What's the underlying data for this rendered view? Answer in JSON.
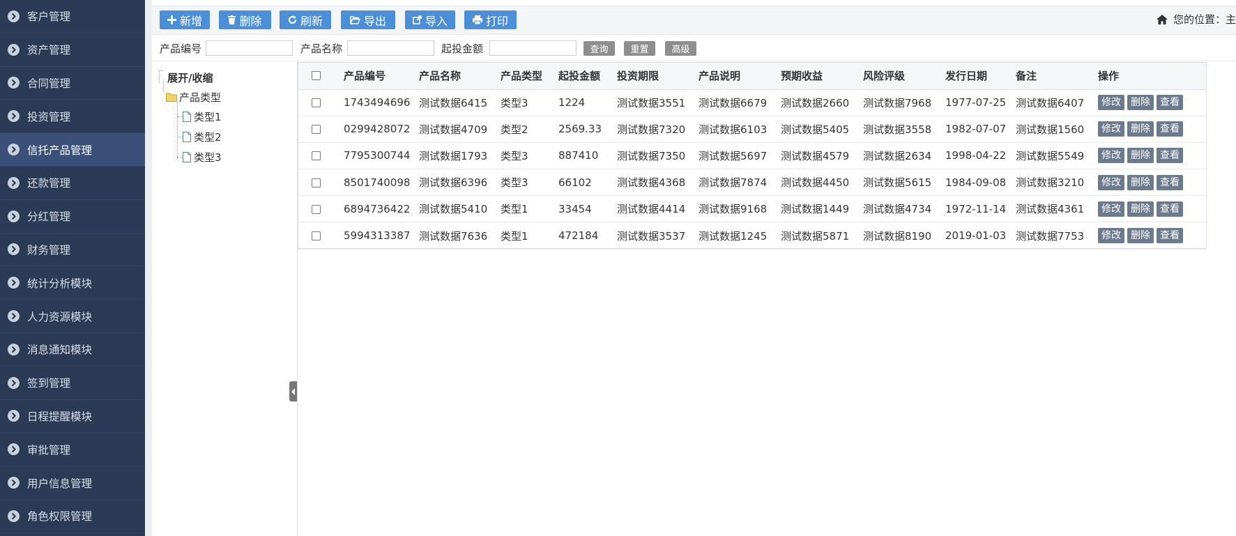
{
  "sidebar": {
    "items": [
      {
        "label": "客户管理",
        "active": false
      },
      {
        "label": "资产管理",
        "active": false
      },
      {
        "label": "合同管理",
        "active": false
      },
      {
        "label": "投资管理",
        "active": false
      },
      {
        "label": "信托产品管理",
        "active": true
      },
      {
        "label": "还款管理",
        "active": false
      },
      {
        "label": "分红管理",
        "active": false
      },
      {
        "label": "财务管理",
        "active": false
      },
      {
        "label": "统计分析模块",
        "active": false
      },
      {
        "label": "人力资源模块",
        "active": false
      },
      {
        "label": "消息通知模块",
        "active": false
      },
      {
        "label": "签到管理",
        "active": false
      },
      {
        "label": "日程提醒模块",
        "active": false
      },
      {
        "label": "审批管理",
        "active": false
      },
      {
        "label": "用户信息管理",
        "active": false
      },
      {
        "label": "角色权限管理",
        "active": false
      }
    ]
  },
  "toolbar": {
    "add": "新增",
    "delete": "删除",
    "refresh": "刷新",
    "export": "导出",
    "import": "导入",
    "print": "打印",
    "location_label": "您的位置：主"
  },
  "search": {
    "code_label": "产品编号",
    "name_label": "产品名称",
    "amount_label": "起投金额",
    "query": "查询",
    "reset": "重置",
    "advanced": "高级"
  },
  "tree": {
    "toggle": "展开/收缩",
    "root": "产品类型",
    "children": [
      "类型1",
      "类型2",
      "类型3"
    ]
  },
  "table": {
    "columns": [
      "产品编号",
      "产品名称",
      "产品类型",
      "起投金额",
      "投资期限",
      "产品说明",
      "预期收益",
      "风险评级",
      "发行日期",
      "备注",
      "操作"
    ],
    "rows": [
      [
        "1743494696",
        "测试数据6415",
        "类型3",
        "1224",
        "测试数据3551",
        "测试数据6679",
        "测试数据2660",
        "测试数据7968",
        "1977-07-25",
        "测试数据6407"
      ],
      [
        "0299428072",
        "测试数据4709",
        "类型2",
        "2569.33",
        "测试数据7320",
        "测试数据6103",
        "测试数据5405",
        "测试数据3558",
        "1982-07-07",
        "测试数据1560"
      ],
      [
        "7795300744",
        "测试数据1793",
        "类型3",
        "887410",
        "测试数据7350",
        "测试数据5697",
        "测试数据4579",
        "测试数据2634",
        "1998-04-22",
        "测试数据5549"
      ],
      [
        "8501740098",
        "测试数据6396",
        "类型3",
        "66102",
        "测试数据4368",
        "测试数据7874",
        "测试数据4450",
        "测试数据5615",
        "1984-09-08",
        "测试数据3210"
      ],
      [
        "6894736422",
        "测试数据5410",
        "类型1",
        "33454",
        "测试数据4414",
        "测试数据9168",
        "测试数据1449",
        "测试数据4734",
        "1972-11-14",
        "测试数据4361"
      ],
      [
        "5994313387",
        "测试数据7636",
        "类型1",
        "472184",
        "测试数据3537",
        "测试数据1245",
        "测试数据5871",
        "测试数据8190",
        "2019-01-03",
        "测试数据7753"
      ]
    ],
    "actions": {
      "edit": "修改",
      "delete": "删除",
      "view": "查看"
    }
  }
}
